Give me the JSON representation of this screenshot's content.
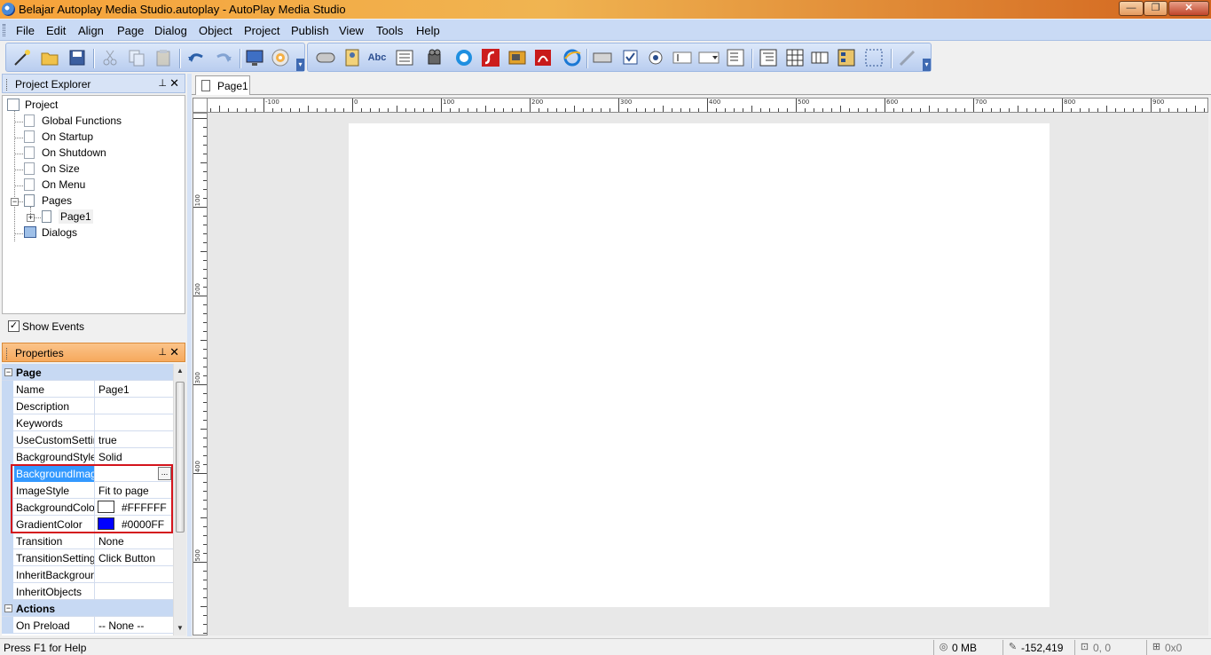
{
  "window": {
    "title": "Belajar Autoplay Media Studio.autoplay - AutoPlay Media Studio",
    "minimize": "—",
    "maximize": "❐",
    "close": "✕"
  },
  "menu": [
    "File",
    "Edit",
    "Align",
    "Page",
    "Dialog",
    "Object",
    "Project",
    "Publish",
    "View",
    "Tools",
    "Help"
  ],
  "toolbar": {
    "text_object_label": "Abc"
  },
  "project_explorer": {
    "title": "Project Explorer",
    "pin": "📌",
    "close": "✕",
    "tree": {
      "root": "Project",
      "events": [
        "Global Functions",
        "On Startup",
        "On Shutdown",
        "On Size",
        "On Menu"
      ],
      "pages_label": "Pages",
      "page1": "Page1",
      "dialogs_label": "Dialogs"
    },
    "show_events_label": "Show Events",
    "show_events_checked": "✓"
  },
  "properties": {
    "title": "Properties",
    "page_category": "Page",
    "actions_category": "Actions",
    "rows": {
      "name": {
        "label": "Name",
        "value": "Page1"
      },
      "description": {
        "label": "Description",
        "value": ""
      },
      "keywords": {
        "label": "Keywords",
        "value": ""
      },
      "use_custom_settings": {
        "label": "UseCustomSettings",
        "value": "true"
      },
      "background_style": {
        "label": "BackgroundStyle",
        "value": "Solid"
      },
      "background_image": {
        "label": "BackgroundImage",
        "value": "",
        "button": "..."
      },
      "image_style": {
        "label": "ImageStyle",
        "value": "Fit to page"
      },
      "background_color": {
        "label": "BackgroundColor",
        "value": "#FFFFFF",
        "swatch": "#FFFFFF"
      },
      "gradient_color": {
        "label": "GradientColor",
        "value": "#0000FF",
        "swatch": "#0000FF"
      },
      "transition": {
        "label": "Transition",
        "value": "None"
      },
      "transition_settings": {
        "label": "TransitionSettings",
        "value": "Click Button"
      },
      "inherit_background": {
        "label": "InheritBackground",
        "value": ""
      },
      "inherit_objects": {
        "label": "InheritObjects",
        "value": ""
      },
      "on_preload": {
        "label": "On Preload",
        "value": "-- None --"
      }
    }
  },
  "document": {
    "tab_label": "Page1",
    "ruler_h_labels": [
      "-100",
      "0",
      "100",
      "200",
      "300",
      "400",
      "500",
      "600",
      "700",
      "800",
      "900"
    ],
    "ruler_v_labels": [
      "100",
      "200",
      "300",
      "400",
      "500"
    ]
  },
  "statusbar": {
    "help_text": "Press F1 for Help",
    "memory": "0 MB",
    "cursor_position": "-152,419",
    "selection_position": "0, 0",
    "selection_size": "0x0"
  },
  "colors": {
    "title_gradient_start": "#f6a23a",
    "title_gradient_end": "#d2641e",
    "menu_bg": "#c9daf5",
    "selection": "#3399ff",
    "highlight_border": "#d4141c"
  }
}
